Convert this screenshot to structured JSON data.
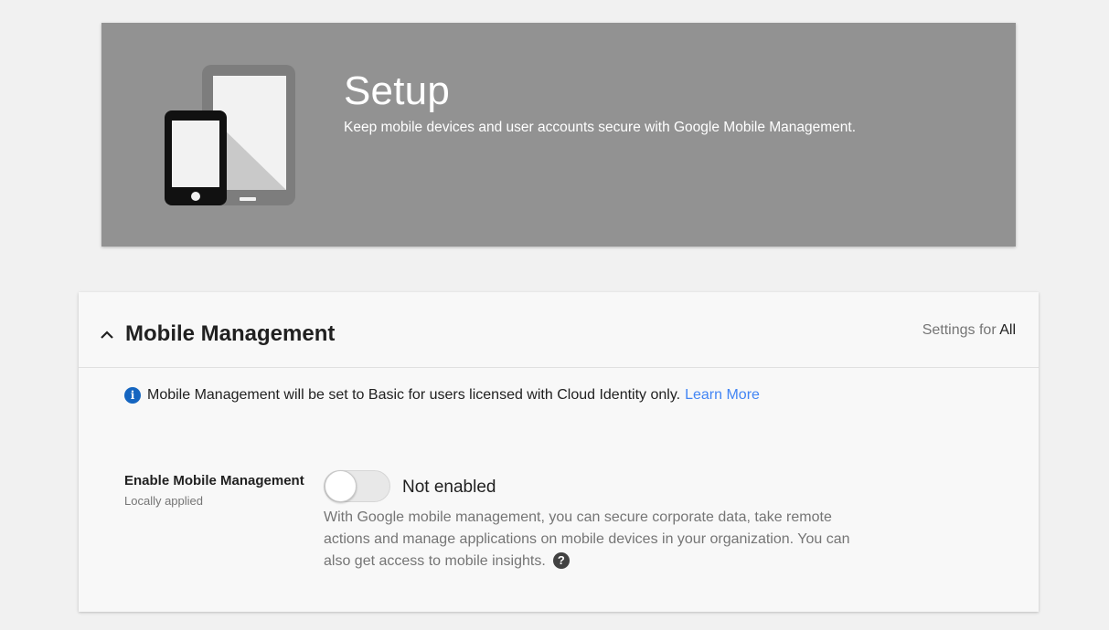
{
  "banner": {
    "title": "Setup",
    "subtitle": "Keep mobile devices and user accounts secure with Google Mobile Management.",
    "illustration_icon": "mobile-devices-icon"
  },
  "section": {
    "title": "Mobile Management",
    "collapse_icon": "chevron-up-icon",
    "settings_for_prefix": "Settings for",
    "settings_for_value": "All"
  },
  "info": {
    "icon": "info-icon",
    "message": "Mobile Management will be set to Basic for users licensed with Cloud Identity only.",
    "link": "Learn More"
  },
  "setting": {
    "label": "Enable Mobile Management",
    "sublabel": "Locally applied",
    "enabled": false,
    "state_text": "Not enabled",
    "description": "With Google mobile management, you can secure corporate data, take remote actions and manage applications on mobile devices in your organization. You can also get access to mobile insights.",
    "help_icon": "help-icon"
  },
  "colors": {
    "banner_bg": "#929292",
    "link": "#4285f4",
    "info": "#1565c0"
  }
}
